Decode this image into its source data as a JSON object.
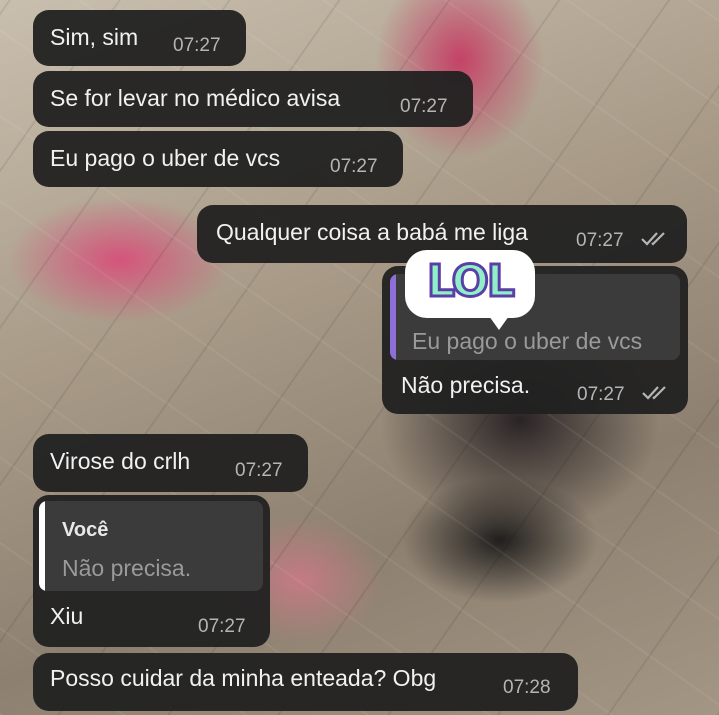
{
  "messages": [
    {
      "text": "Sim, sim",
      "time": "07:27"
    },
    {
      "text": "Se for levar no médico avisa",
      "time": "07:27"
    },
    {
      "text": "Eu pago o uber de vcs",
      "time": "07:27"
    },
    {
      "text": "Qualquer coisa a babá me liga",
      "time": "07:27"
    },
    {
      "text": "Não precisa.",
      "time": "07:27",
      "quote": {
        "text": "Eu pago o uber de vcs"
      }
    },
    {
      "text": "Virose do crlh",
      "time": "07:27"
    },
    {
      "text": "Xiu",
      "time": "07:27",
      "quote": {
        "author": "Você",
        "text": "Não precisa."
      }
    },
    {
      "text": "Posso cuidar da minha enteada? Obg",
      "time": "07:28"
    }
  ],
  "sticker": {
    "text": "LOL"
  },
  "colors": {
    "bubble": "#212121",
    "quote_bar_incoming": "#ffffff",
    "quote_bar_outgoing": "#8e6fd8",
    "read_ticks": "#b5b5b5"
  },
  "icons": {
    "read_receipt": "double-check-icon"
  }
}
